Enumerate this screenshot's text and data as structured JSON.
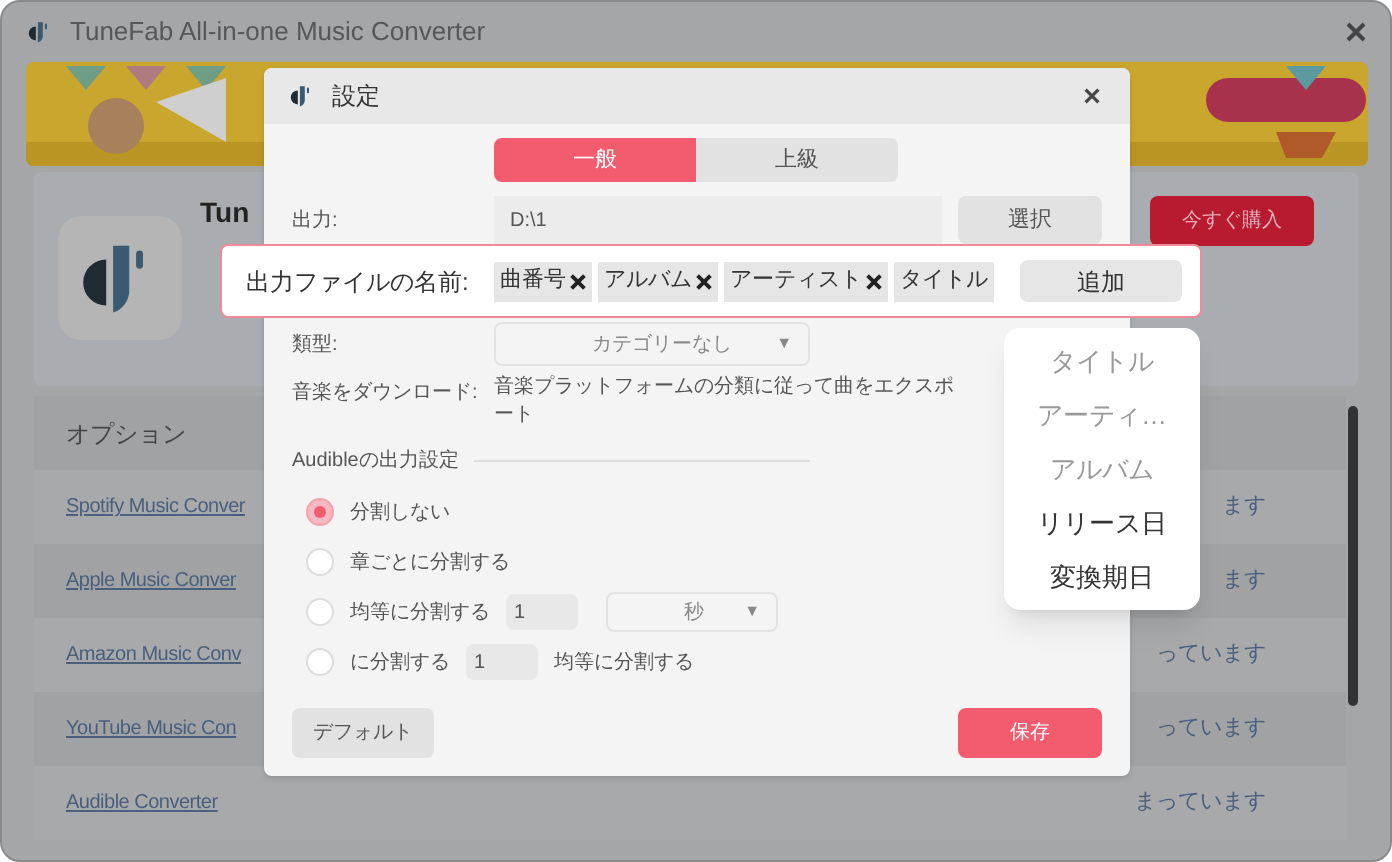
{
  "window": {
    "title": "TuneFab All-in-one Music Converter"
  },
  "product": {
    "title": "Tun",
    "buy_button": "今すぐ購入"
  },
  "table": {
    "header": "オプション",
    "rows": [
      {
        "name": "Spotify Music Conver",
        "status": "ます"
      },
      {
        "name": "Apple Music Conver",
        "status": "ます"
      },
      {
        "name": "Amazon Music Conv",
        "status": "っています"
      },
      {
        "name": "YouTube Music Con",
        "status": "っています"
      },
      {
        "name": "Audible Converter",
        "status": "まっています"
      }
    ]
  },
  "dialog": {
    "title": "設定",
    "tabs": [
      {
        "label": "一般",
        "selected": true
      },
      {
        "label": "上級",
        "selected": false
      }
    ],
    "output": {
      "label": "出力:",
      "value": "D:\\1",
      "button": "選択"
    },
    "filename": {
      "label": "出力ファイルの名前:",
      "tags": [
        {
          "label": "曲番号",
          "removable": true
        },
        {
          "label": "アルバム",
          "removable": true
        },
        {
          "label": "アーティスト",
          "removable": true
        },
        {
          "label": "タイトル",
          "removable": false
        }
      ],
      "button": "追加"
    },
    "category": {
      "label": "類型:",
      "value": "カテゴリーなし",
      "arrow": "▼"
    },
    "download": {
      "label": "音楽をダウンロード:",
      "text": "音楽プラットフォームの分類に従って曲をエクスポート"
    },
    "audible": {
      "title": "Audibleの出力設定",
      "options": [
        {
          "kind": "plain",
          "label": "分割しない",
          "selected": true
        },
        {
          "kind": "plain",
          "label": "章ごとに分割する",
          "selected": false
        },
        {
          "kind": "time",
          "label": "均等に分割する",
          "value": "1",
          "unit": "秒",
          "arrow": "▼",
          "selected": false
        },
        {
          "kind": "count",
          "label": "に分割する",
          "value": "1",
          "suffix": "均等に分割する",
          "selected": false
        }
      ]
    },
    "default_button": "デフォルト",
    "save_button": "保存"
  },
  "menu": {
    "items": [
      {
        "label": "タイトル",
        "disabled": true
      },
      {
        "label": "アーティ…",
        "disabled": true
      },
      {
        "label": "アルバム",
        "disabled": true
      },
      {
        "label": "リリース日",
        "disabled": false
      },
      {
        "label": "変換期日",
        "disabled": false
      }
    ]
  }
}
